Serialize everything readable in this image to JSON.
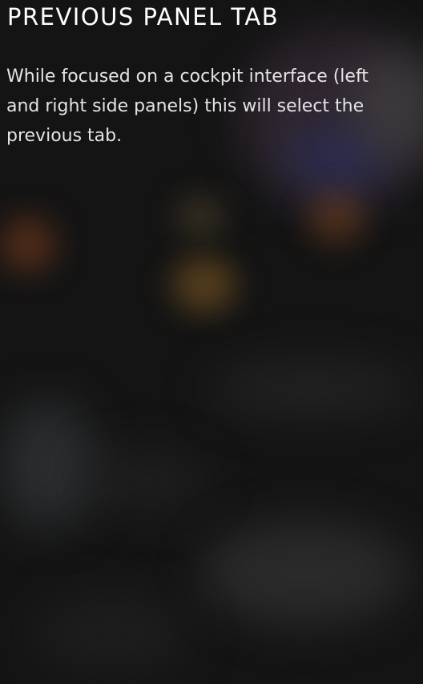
{
  "panel": {
    "title": "PREVIOUS PANEL TAB",
    "description": "While focused on a cockpit interface (left and right side panels) this will select the previous tab."
  }
}
